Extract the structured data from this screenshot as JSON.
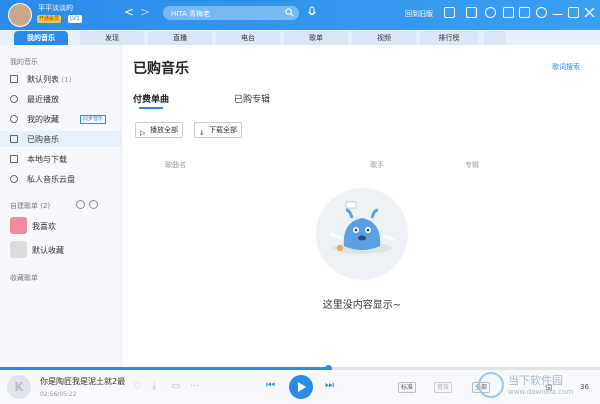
{
  "user": {
    "name": "平平淡淡的",
    "vip_badge": "开通会员",
    "level": "LV.1"
  },
  "nav": {
    "back": "<",
    "forward": ">",
    "refresh": "○"
  },
  "search": {
    "placeholder": "HITA 青梅老"
  },
  "toolbar": {
    "old_version": "回到旧版"
  },
  "tabs": [
    {
      "label": "我的音乐",
      "active": true
    },
    {
      "label": "发现"
    },
    {
      "label": "直播"
    },
    {
      "label": "电台"
    },
    {
      "label": "歌单"
    },
    {
      "label": "视频"
    },
    {
      "label": "排行榜"
    }
  ],
  "search_song": "歌词搜索",
  "sidebar": {
    "my_music_header": "我的音乐",
    "items": [
      {
        "label": "默认列表",
        "count": "(1)"
      },
      {
        "label": "最近播放"
      },
      {
        "label": "我的收藏",
        "tag": "同步音乐"
      },
      {
        "label": "已购音乐",
        "active": true
      },
      {
        "label": "本地与下载"
      },
      {
        "label": "私人音乐云盘"
      }
    ],
    "created_header": "自建歌单",
    "created_count": "(2)",
    "playlists": [
      {
        "label": "我喜欢",
        "color": "#f48aa0"
      },
      {
        "label": "默认收藏",
        "color": "#dcdcdc"
      }
    ],
    "collected_header": "收藏歌单"
  },
  "main": {
    "title": "已购音乐",
    "subtabs": [
      {
        "label": "付费单曲",
        "active": true
      },
      {
        "label": "已购专辑"
      }
    ],
    "buttons": {
      "play_all": "播放全部",
      "download_all": "下载全部"
    },
    "columns": [
      "歌曲名",
      "歌手",
      "专辑"
    ],
    "empty_text": "这里没内容显示~"
  },
  "player": {
    "cover_letter": "K",
    "song_title": "你是陶匠我是泥土就2最",
    "time": "02:56/05:22",
    "progress": 0.547,
    "quality": "标准",
    "quality_badge": "音效",
    "mode": "全部",
    "lyrics": "词",
    "volume": "36"
  },
  "watermark": {
    "title": "当下软件园",
    "url": "www.downxia.com"
  },
  "colors": {
    "accent": "#2a8ce8"
  }
}
